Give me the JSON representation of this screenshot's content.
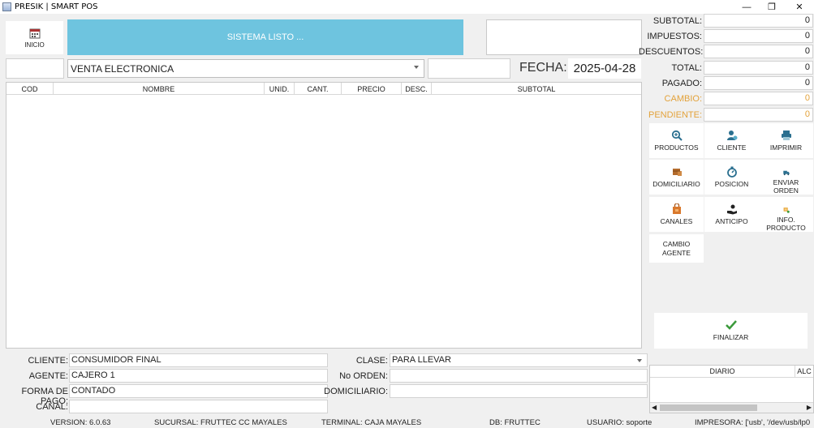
{
  "window": {
    "title": "PRESIK | SMART POS"
  },
  "top": {
    "inicio_label": "INICIO",
    "status_text": "SISTEMA LISTO ...",
    "sale_type": "VENTA ELECTRONICA",
    "fecha_label": "FECHA:",
    "fecha_value": "2025-04-28"
  },
  "table": {
    "columns": [
      "COD",
      "NOMBRE",
      "UNID.",
      "CANT.",
      "PRECIO",
      "DESC.",
      "SUBTOTAL"
    ]
  },
  "totals": [
    {
      "label": "SUBTOTAL:",
      "value": "0",
      "highlight": false
    },
    {
      "label": "IMPUESTOS:",
      "value": "0",
      "highlight": false
    },
    {
      "label": "DESCUENTOS:",
      "value": "0",
      "highlight": false
    },
    {
      "label": "TOTAL:",
      "value": "0",
      "highlight": false
    },
    {
      "label": "PAGADO:",
      "value": "0",
      "highlight": false
    },
    {
      "label": "CAMBIO:",
      "value": "0",
      "highlight": true
    },
    {
      "label": "PENDIENTE:",
      "value": "0",
      "highlight": true
    }
  ],
  "actions": {
    "productos": "PRODUCTOS",
    "cliente": "CLIENTE",
    "imprimir": "IMPRIMIR",
    "domiciliario": "DOMICILIARIO",
    "posicion": "POSICION",
    "enviar_orden": "ENVIAR ORDEN",
    "canales": "CANALES",
    "anticipo": "ANTICIPO",
    "info_producto": "INFO. PRODUCTO",
    "cambio_agente": "CAMBIO AGENTE",
    "finalizar": "FINALIZAR"
  },
  "form": {
    "cliente_label": "CLIENTE:",
    "cliente_value": "CONSUMIDOR FINAL",
    "agente_label": "AGENTE:",
    "agente_value": "CAJERO 1",
    "forma_pago_label": "FORMA DE PAGO:",
    "forma_pago_value": "CONTADO",
    "canal_label": "CANAL:",
    "canal_value": "",
    "clase_label": "CLASE:",
    "clase_value": "PARA LLEVAR",
    "no_orden_label": "No ORDEN:",
    "no_orden_value": "",
    "domiciliario_label": "DOMICILIARIO:",
    "domiciliario_value": ""
  },
  "diario": {
    "col1": "DIARIO",
    "col2": "ALC"
  },
  "statusbar": {
    "version": "VERSION:  6.0.63",
    "sucursal": "SUCURSAL:  FRUTTEC CC MAYALES",
    "terminal": "TERMINAL:  CAJA MAYALES",
    "db": "DB:  FRUTTEC",
    "usuario": "USUARIO:  soporte",
    "impresora": "IMPRESORA:  ['usb', '/dev/usb/lp0"
  },
  "colors": {
    "status_bg": "#6ec4df",
    "accent_blue": "#2a6f8f",
    "orange": "#e3a23a",
    "green": "#3b9a3b"
  }
}
